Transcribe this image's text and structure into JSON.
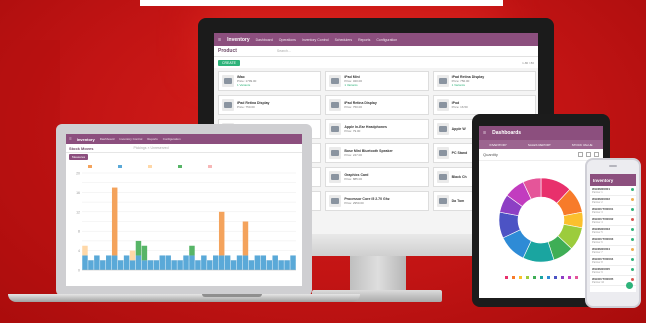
{
  "colors": {
    "background": "#c41414",
    "brand": "#8c4f7e",
    "success": "#2eb37a"
  },
  "monitor": {
    "app_title": "Inventory",
    "menu": [
      "Dashboard",
      "Operations",
      "Inventory Control",
      "Schedulers",
      "Reports",
      "Configuration"
    ],
    "breadcrumb": "Product",
    "search_placeholder": "Search...",
    "create_label": "CREATE",
    "pager": "1-80 / 80",
    "cards": [
      {
        "name": "iMac",
        "price": "Price: 1799.00",
        "stock": "1 Variants"
      },
      {
        "name": "iPad Mini",
        "price": "Price: 320.00",
        "stock": "1 Variants"
      },
      {
        "name": "iPad Retina Display",
        "price": "Price: 750.00",
        "stock": "1 Variants"
      },
      {
        "name": "iPad Retina Display",
        "price": "Price: 750.00",
        "stock": ""
      },
      {
        "name": "iPad Retina Display",
        "price": "Price: 750.00",
        "stock": ""
      },
      {
        "name": "iPod",
        "price": "Price: 16.50",
        "stock": ""
      },
      {
        "name": "",
        "price": "",
        "stock": ""
      },
      {
        "name": "Apple In-Ear Headphones",
        "price": "Price: 79.00",
        "stock": ""
      },
      {
        "name": "Apple W",
        "price": "",
        "stock": ""
      },
      {
        "name": "",
        "price": "",
        "stock": ""
      },
      {
        "name": "Bose Mini Bluetooth Speaker",
        "price": "Price: 247.00",
        "stock": ""
      },
      {
        "name": "PC Stand",
        "price": "",
        "stock": ""
      },
      {
        "name": "",
        "price": "",
        "stock": ""
      },
      {
        "name": "Graphics Card",
        "price": "Price: 885.00",
        "stock": ""
      },
      {
        "name": "Black Ch",
        "price": "",
        "stock": ""
      },
      {
        "name": "",
        "price": "",
        "stock": ""
      },
      {
        "name": "Processor Core i5 2.70 Ghz",
        "price": "Price: 2950.00",
        "stock": ""
      },
      {
        "name": "Da Tom",
        "price": "",
        "stock": ""
      }
    ]
  },
  "laptop": {
    "app_title": "Inventory",
    "menu": [
      "Dashboard",
      "Inventory Control",
      "Reports",
      "Configuration"
    ],
    "breadcrumb": "Stock Moves",
    "search_placeholder": "Pickings × Unreserved",
    "button_label": "Measures"
  },
  "tablet": {
    "app_title": "Dashboards",
    "tabs": [
      "INVENTORY",
      "SALES REPORT",
      "STOCK VALUE"
    ],
    "measure": "Quantity"
  },
  "phone": {
    "app_title": "Inventory",
    "rows": [
      {
        "title": "WH/IN/00001",
        "subtitle": "Partner 1"
      },
      {
        "title": "WH/IN/00002",
        "subtitle": "Partner 2"
      },
      {
        "title": "WH/OUT/00001",
        "subtitle": "Partner 3"
      },
      {
        "title": "WH/OUT/00002",
        "subtitle": "Partner 4"
      },
      {
        "title": "WH/IN/00003",
        "subtitle": "Partner 5"
      },
      {
        "title": "WH/OUT/00003",
        "subtitle": "Partner 6"
      },
      {
        "title": "WH/IN/00004",
        "subtitle": "Partner 7"
      },
      {
        "title": "WH/OUT/00004",
        "subtitle": "Partner 8"
      },
      {
        "title": "WH/IN/00005",
        "subtitle": "Partner 9"
      },
      {
        "title": "WH/OUT/00005",
        "subtitle": "Partner 10"
      }
    ]
  },
  "chart_data": [
    {
      "type": "bar",
      "ylim": [
        0,
        20
      ],
      "grid": true,
      "categories": [
        "1",
        "2",
        "3",
        "4",
        "5",
        "6",
        "7",
        "8",
        "9",
        "10",
        "11",
        "12",
        "13",
        "14",
        "15",
        "16",
        "17",
        "18",
        "19",
        "20",
        "21",
        "22",
        "23",
        "24",
        "25",
        "26",
        "27",
        "28",
        "29",
        "30",
        "31",
        "32",
        "33",
        "34",
        "35",
        "36"
      ],
      "series": [
        {
          "color": "#f4a35c",
          "values": [
            0,
            0,
            0,
            0,
            0,
            14,
            0,
            0,
            0,
            0,
            0,
            0,
            0,
            0,
            0,
            0,
            0,
            0,
            0,
            0,
            0,
            0,
            0,
            9,
            0,
            0,
            0,
            7,
            0,
            0,
            0,
            0,
            0,
            0,
            0,
            0
          ]
        },
        {
          "color": "#5aa9d8",
          "values": [
            3,
            2,
            3,
            2,
            3,
            3,
            2,
            3,
            2,
            3,
            2,
            2,
            2,
            3,
            3,
            2,
            2,
            3,
            3,
            2,
            3,
            2,
            3,
            3,
            3,
            2,
            3,
            3,
            2,
            3,
            3,
            2,
            3,
            2,
            2,
            3
          ]
        },
        {
          "color": "#ffd8a8",
          "values": [
            2,
            0,
            0,
            0,
            0,
            0,
            0,
            0,
            2,
            0,
            0,
            0,
            0,
            0,
            0,
            0,
            0,
            0,
            0,
            0,
            0,
            0,
            0,
            0,
            0,
            0,
            0,
            0,
            0,
            0,
            0,
            0,
            0,
            0,
            0,
            0
          ]
        },
        {
          "color": "#57b567",
          "values": [
            0,
            0,
            0,
            0,
            0,
            0,
            0,
            0,
            0,
            3,
            3,
            0,
            0,
            0,
            0,
            0,
            0,
            0,
            2,
            0,
            0,
            0,
            0,
            0,
            0,
            0,
            0,
            0,
            0,
            0,
            0,
            0,
            0,
            0,
            0,
            0
          ]
        },
        {
          "color": "#f7b7b7",
          "values": [
            0,
            0,
            0,
            0,
            0,
            0,
            0,
            0,
            0,
            0,
            0,
            0,
            0,
            0,
            0,
            0,
            0,
            0,
            0,
            0,
            0,
            0,
            0,
            0,
            0,
            0,
            0,
            0,
            0,
            0,
            0,
            0,
            0,
            0,
            0,
            0
          ]
        }
      ]
    },
    {
      "type": "pie",
      "donut": true,
      "values": [
        12,
        10,
        6,
        9,
        8,
        12,
        11,
        10,
        7,
        8,
        7
      ],
      "colors": [
        "#e8306c",
        "#f77b2a",
        "#fbc02d",
        "#9ccc3c",
        "#3fae56",
        "#1aa5a0",
        "#2e8bd6",
        "#4c53c4",
        "#8d3fc4",
        "#c23cbf",
        "#e55599"
      ]
    }
  ]
}
